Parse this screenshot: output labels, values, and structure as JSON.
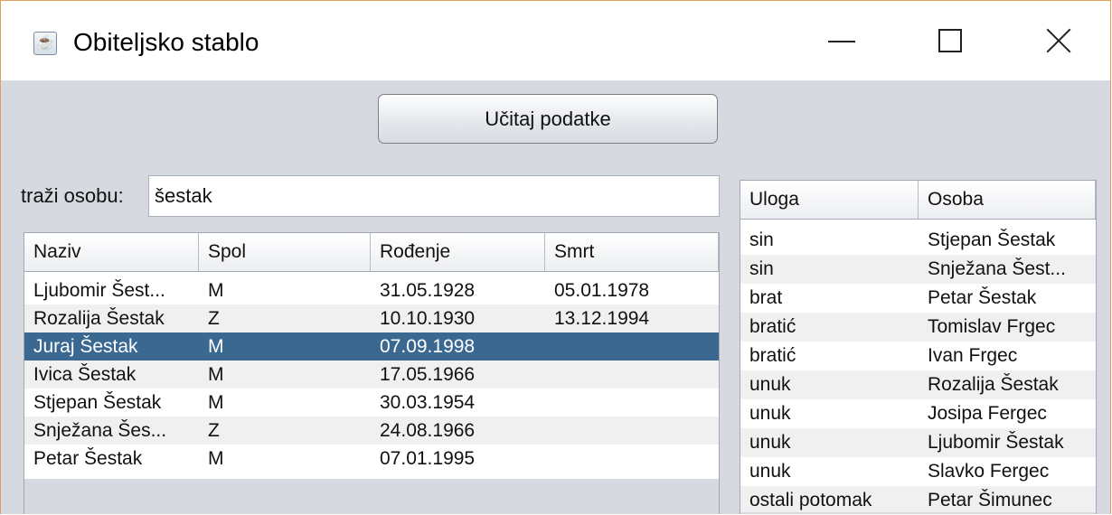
{
  "window": {
    "title": "Obiteljsko stablo",
    "icon": "java-icon"
  },
  "load_button": {
    "label": "Učitaj podatke"
  },
  "search": {
    "label": "traži osobu:",
    "value": "šestak"
  },
  "persons_table": {
    "columns": [
      "Naziv",
      "Spol",
      "Rođenje",
      "Smrt"
    ],
    "rows": [
      [
        "Ljubomir Šest...",
        "M",
        "31.05.1928",
        "05.01.1978"
      ],
      [
        "Rozalija Šestak",
        "Z",
        "10.10.1930",
        "13.12.1994"
      ],
      [
        "Juraj Šestak",
        "M",
        "07.09.1998",
        ""
      ],
      [
        "Ivica Šestak",
        "M",
        "17.05.1966",
        ""
      ],
      [
        "Stjepan Šestak",
        "M",
        "30.03.1954",
        ""
      ],
      [
        "Snježana Šes...",
        "Z",
        "24.08.1966",
        ""
      ],
      [
        "Petar Šestak",
        "M",
        "07.01.1995",
        ""
      ]
    ],
    "selected_row": 2,
    "selection_color": "#3a6890"
  },
  "relations_table": {
    "columns": [
      "Uloga",
      "Osoba"
    ],
    "rows": [
      [
        "sin",
        "Stjepan Šestak"
      ],
      [
        "sin",
        "Snježana Šest..."
      ],
      [
        "brat",
        "Petar Šestak"
      ],
      [
        "bratić",
        "Tomislav Frgec"
      ],
      [
        "bratić",
        "Ivan Frgec"
      ],
      [
        "unuk",
        "Rozalija Šestak"
      ],
      [
        "unuk",
        "Josipa Fergec"
      ],
      [
        "unuk",
        "Ljubomir Šestak"
      ],
      [
        "unuk",
        "Slavko Fergec"
      ],
      [
        "ostali potomak",
        "Petar Šimunec"
      ]
    ]
  }
}
